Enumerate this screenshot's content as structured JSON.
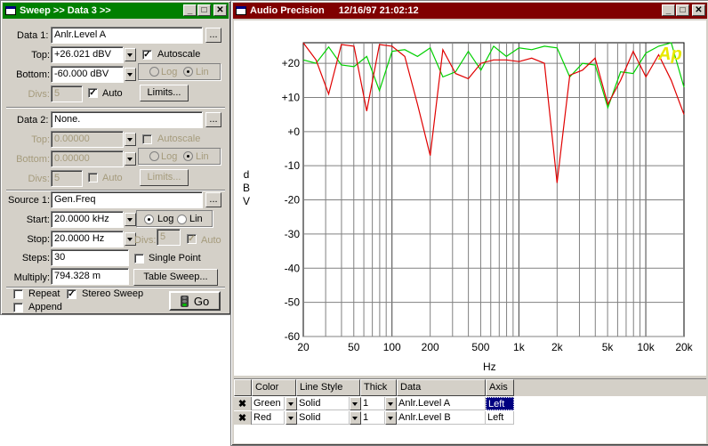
{
  "sweep": {
    "title": "Sweep >> Data 3 >>",
    "data1": {
      "label": "Data 1:",
      "value": "Anlr.Level A",
      "browse": "...",
      "top_label": "Top:",
      "top": "+26.021  dBV",
      "autoscale": "Autoscale",
      "bottom_label": "Bottom:",
      "bottom": "-60.000  dBV",
      "log": "Log",
      "lin": "Lin",
      "divs_label": "Divs:",
      "divs": "5",
      "auto": "Auto",
      "limits": "Limits..."
    },
    "data2": {
      "label": "Data 2:",
      "value": "None.",
      "browse": "...",
      "top_label": "Top:",
      "top": "0.00000",
      "autoscale": "Autoscale",
      "bottom_label": "Bottom:",
      "bottom": "0.00000",
      "log": "Log",
      "lin": "Lin",
      "divs_label": "Divs:",
      "divs": "5",
      "auto": "Auto",
      "limits": "Limits..."
    },
    "source1": {
      "label": "Source 1:",
      "value": "Gen.Freq",
      "browse": "...",
      "start_label": "Start:",
      "start": "20.0000 kHz",
      "log": "Log",
      "lin": "Lin",
      "stop_label": "Stop:",
      "stop": "20.0000  Hz",
      "divs_label": "Divs:",
      "divs": "5",
      "auto": "Auto",
      "steps_label": "Steps:",
      "steps": "30",
      "single_point": "Single Point",
      "multiply_label": "Multiply:",
      "multiply": "794.328 m",
      "table_sweep": "Table Sweep..."
    },
    "repeat": "Repeat",
    "stereo_sweep": "Stereo Sweep",
    "append": "Append",
    "go": "Go"
  },
  "graph": {
    "title": "Audio Precision",
    "timestamp": "12/16/97 21:02:12",
    "logo": "Ap",
    "ylabel_chars": [
      "d",
      "B",
      "V"
    ],
    "xlabel": "Hz"
  },
  "chart_data": {
    "type": "line",
    "xscale": "log",
    "xlim": [
      20,
      20000
    ],
    "ylim": [
      -60,
      26.021
    ],
    "grid": true,
    "xticks": [
      {
        "v": 20,
        "label": "20"
      },
      {
        "v": 50,
        "label": "50"
      },
      {
        "v": 100,
        "label": "100"
      },
      {
        "v": 200,
        "label": "200"
      },
      {
        "v": 500,
        "label": "500"
      },
      {
        "v": 1000,
        "label": "1k"
      },
      {
        "v": 2000,
        "label": "2k"
      },
      {
        "v": 5000,
        "label": "5k"
      },
      {
        "v": 10000,
        "label": "10k"
      },
      {
        "v": 20000,
        "label": "20k"
      }
    ],
    "yticks": [
      {
        "v": 20,
        "label": "+20"
      },
      {
        "v": 10,
        "label": "+10"
      },
      {
        "v": 0,
        "label": "+0"
      },
      {
        "v": -10,
        "label": "-10"
      },
      {
        "v": -20,
        "label": "-20"
      },
      {
        "v": -30,
        "label": "-30"
      },
      {
        "v": -40,
        "label": "-40"
      },
      {
        "v": -50,
        "label": "-50"
      },
      {
        "v": -60,
        "label": "-60"
      }
    ],
    "series": [
      {
        "color": "#00d000",
        "x": [
          20,
          25.2,
          31.7,
          39.9,
          50.2,
          63.2,
          79.6,
          100.2,
          126.2,
          158.9,
          200,
          251.8,
          317,
          399.1,
          502.4,
          632.5,
          796.3,
          1002.5,
          1262,
          1588.7,
          2000,
          2518,
          3170,
          3991,
          5024,
          6325,
          7962,
          10024,
          12619,
          15887,
          20000
        ],
        "y": [
          21,
          20,
          24.8,
          19.5,
          19,
          22,
          12,
          23.5,
          24,
          22,
          24.5,
          16,
          17.5,
          23.5,
          18,
          25,
          22,
          24.5,
          24,
          25,
          24.5,
          16,
          20,
          19.5,
          7,
          17.5,
          17,
          23,
          25,
          26,
          13
        ]
      },
      {
        "color": "#e00000",
        "x": [
          20,
          25.2,
          31.7,
          39.9,
          50.2,
          63.2,
          79.6,
          100.2,
          126.2,
          158.9,
          200,
          251.8,
          317,
          399.1,
          502.4,
          632.5,
          796.3,
          1002.5,
          1262,
          1588.7,
          2000,
          2518,
          3170,
          3991,
          5024,
          6325,
          7962,
          10024,
          12619,
          15887,
          20000
        ],
        "y": [
          26,
          21,
          11,
          25.5,
          25,
          6,
          25.5,
          25,
          22,
          8,
          -7,
          24,
          17,
          15.5,
          20,
          21,
          21,
          20.5,
          21.5,
          20,
          -15,
          16.5,
          18,
          21.5,
          8,
          15,
          23.5,
          16,
          22.5,
          15,
          5
        ]
      }
    ]
  },
  "grid": {
    "headers": [
      "Color",
      "Line Style",
      "Thick",
      "Data",
      "Axis"
    ],
    "rows": [
      {
        "color": "Green",
        "style": "Solid",
        "thick": "1",
        "data": "Anlr.Level A",
        "axis": "Left"
      },
      {
        "color": "Red",
        "style": "Solid",
        "thick": "1",
        "data": "Anlr.Level B",
        "axis": "Left"
      }
    ]
  },
  "colors": {
    "title_active": "#008000",
    "title_graph": "#800000",
    "selected": "#000080"
  }
}
